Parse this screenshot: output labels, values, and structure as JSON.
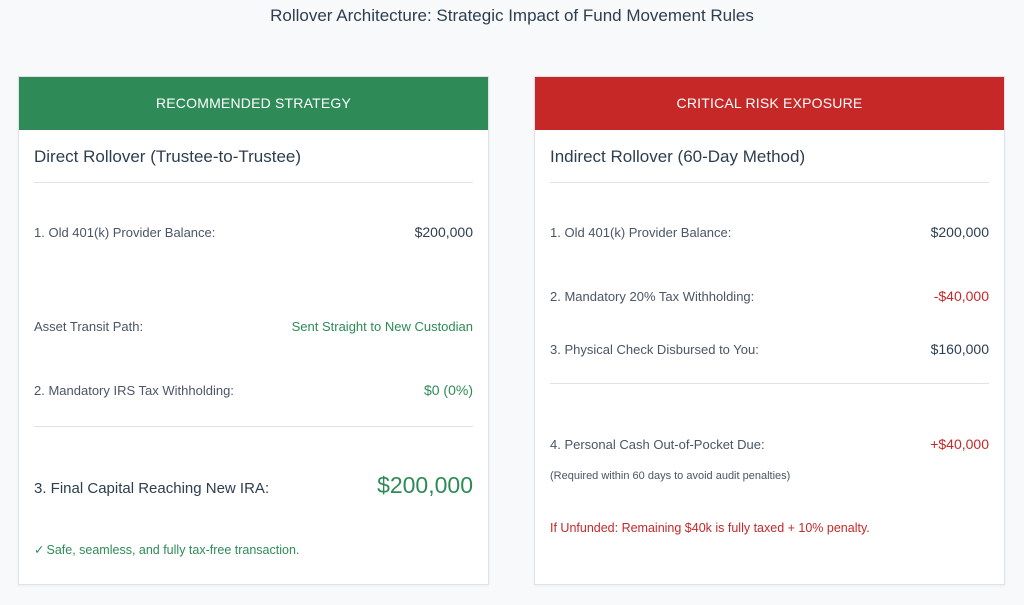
{
  "page": {
    "title": "Rollover Architecture: Strategic Impact of Fund Movement Rules"
  },
  "left": {
    "header": "RECOMMENDED STRATEGY",
    "title": "Direct Rollover (Trustee-to-Trustee)",
    "rows": [
      {
        "label": "1. Old 401(k) Provider Balance:",
        "value": "$200,000"
      },
      {
        "label": "Asset Transit Path:",
        "value": "Sent Straight to New Custodian"
      },
      {
        "label": "2. Mandatory IRS Tax Withholding:",
        "value": "$0 (0%)"
      }
    ],
    "final": {
      "label": "3. Final Capital Reaching New IRA:",
      "value": "$200,000"
    },
    "note": "Safe, seamless, and fully tax-free transaction.",
    "check_icon": "✓",
    "colors": {
      "header": "#2e8b57",
      "accent": "#2e8b57"
    }
  },
  "right": {
    "header": "CRITICAL RISK EXPOSURE",
    "title": "Indirect Rollover (60-Day Method)",
    "rows": [
      {
        "label": "1. Old 401(k) Provider Balance:",
        "value": "$200,000"
      },
      {
        "label": "2. Mandatory 20% Tax Withholding:",
        "value": "-$40,000"
      },
      {
        "label": "3. Physical Check Disbursed to You:",
        "value": "$160,000"
      },
      {
        "label": "4. Personal Cash Out-of-Pocket Due:",
        "value": "+$40,000"
      }
    ],
    "small_note": "(Required within 60 days to avoid audit penalties)",
    "warning": "If Unfunded: Remaining $40k is fully taxed + 10% penalty.",
    "colors": {
      "header": "#c62828",
      "accent": "#c62828"
    }
  }
}
